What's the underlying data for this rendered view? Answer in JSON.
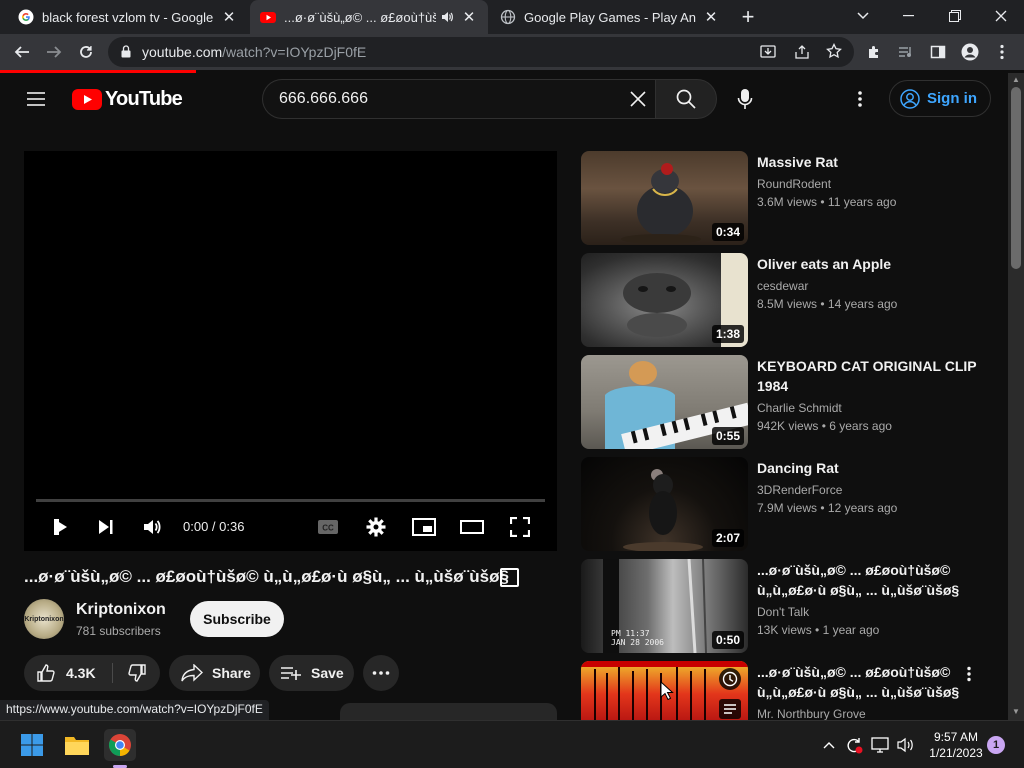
{
  "browser": {
    "tabs": [
      {
        "title": "black forest vzlom tv - Google Se",
        "icon": "google-g-icon",
        "active": false
      },
      {
        "title": "...ø·ø¨ùšù„ø© ... ø£øoù†ùšø©",
        "icon": "youtube-icon",
        "active": true,
        "audio": "speaker-icon"
      },
      {
        "title": "Google Play Games - Play Androi",
        "icon": "globe-icon",
        "active": false
      }
    ],
    "new_tab_label": "+",
    "url_host": "youtube.com",
    "url_path": "/watch?v=IOYpzDjF0fE",
    "status_url": "https://www.youtube.com/watch?v=IOYpzDjF0fE"
  },
  "youtube": {
    "logo_text": "YouTube",
    "search_query": "666.666.666",
    "signin_label": "Sign in",
    "player": {
      "time": "0:00 / 0:36",
      "progress": 0
    },
    "video": {
      "title": "...ø·ø¨ùšù„ø© ... ø£øoù†ùšø© ù„ù„ø£ø·ù ø§ù„ ... ù„ùšø¨ùšø§",
      "channel": "Kriptonixon",
      "avatar_text": "Kriptonixon",
      "subscribers": "781 subscribers",
      "subscribe_label": "Subscribe",
      "likes": "4.3K",
      "share_label": "Share",
      "save_label": "Save"
    },
    "recommendations": [
      {
        "title": "Massive Rat",
        "channel": "RoundRodent",
        "views": "3.6M views",
        "age": "11 years ago",
        "duration": "0:34"
      },
      {
        "title": "Oliver eats an Apple",
        "channel": "cesdewar",
        "views": "8.5M views",
        "age": "14 years ago",
        "duration": "1:38"
      },
      {
        "title": "KEYBOARD CAT ORIGINAL CLIP 1984",
        "channel": "Charlie Schmidt",
        "views": "942K views",
        "age": "6 years ago",
        "duration": "0:55"
      },
      {
        "title": "Dancing Rat",
        "channel": "3DRenderForce",
        "views": "7.9M views",
        "age": "12 years ago",
        "duration": "2:07"
      },
      {
        "title": "...ø·ø¨ùšù„ø© ... ø£øoù†ùšø© ù„ù„ø£ø·ù ø§ù„ ... ù„ùšø¨ùšø§",
        "channel": "Don't Talk",
        "views": "13K views",
        "age": "1 year ago",
        "duration": "0:50",
        "thumb_text": "PM 11:37\nJAN 28 2006"
      },
      {
        "title": "...ø·ø¨ùšù„ø© ... ø£øoù†ùšø© ù„ù„ø£ø·ù ø§ù„ ... ù„ùšø¨ùšø§",
        "channel": "Mr. Northbury Grove",
        "views": "",
        "age": "",
        "duration": ""
      }
    ]
  },
  "taskbar": {
    "time": "9:57 AM",
    "date": "1/21/2023",
    "notification_count": "1"
  },
  "colors": {
    "youtube_red": "#ff0000",
    "link_blue": "#3ea6ff",
    "background": "#0f0f0f"
  }
}
